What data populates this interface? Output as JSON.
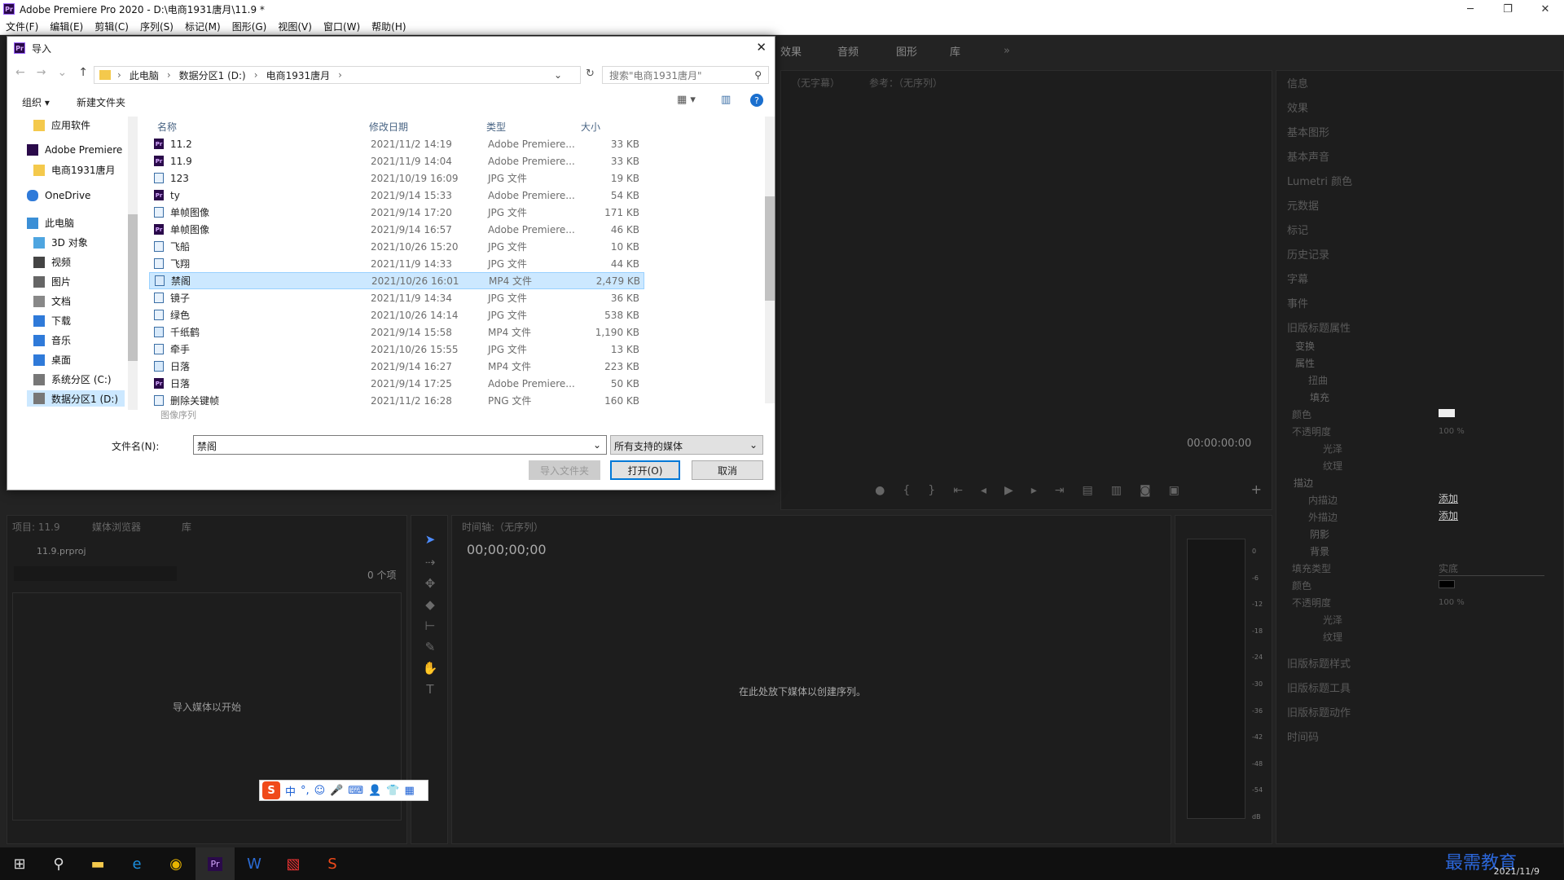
{
  "app": {
    "title": "Adobe Premiere Pro 2020 - D:\\电商1931唐月\\11.9  *",
    "logo": "Pr"
  },
  "window_controls": {
    "minimize": "─",
    "maximize": "❐",
    "close": "✕"
  },
  "menu": [
    "文件(F)",
    "编辑(E)",
    "剪辑(C)",
    "序列(S)",
    "标记(M)",
    "图形(G)",
    "视图(V)",
    "窗口(W)",
    "帮助(H)"
  ],
  "workspace_tabs": [
    "效果",
    "音频",
    "图形",
    "库"
  ],
  "more_tabs": "»",
  "source_monitor": {
    "tab1": "（无字幕）",
    "tab2": "参考：（无序列）",
    "timecode": "00:00:00:00"
  },
  "right_panels": [
    "信息",
    "效果",
    "基本图形",
    "基本声音",
    "Lumetri 颜色",
    "元数据",
    "标记",
    "历史记录",
    "字幕",
    "事件",
    "旧版标题属性"
  ],
  "legacy_title": {
    "transform": "变换",
    "properties": "属性",
    "distort": "扭曲",
    "fill": "填充",
    "color": "颜色",
    "opacity": "不透明度",
    "opacity_val": "100 %",
    "sheen": "光泽",
    "texture": "纹理",
    "strokes": "描边",
    "inner": "内描边",
    "outer": "外描边",
    "add": "添加",
    "shadow": "阴影",
    "background": "背景",
    "fill_type": "填充类型",
    "fill_type_val": "实底",
    "styles": "旧版标题样式",
    "tools": "旧版标题工具",
    "actions": "旧版标题动作",
    "timecode_panel": "时间码"
  },
  "project": {
    "tabs": [
      "项目: 11.9",
      "媒体浏览器",
      "库"
    ],
    "file": "11.9.prproj",
    "count": "0 个项",
    "empty": "导入媒体以开始"
  },
  "timeline": {
    "tab": "时间轴:（无序列）",
    "timecode": "00;00;00;00",
    "empty": "在此处放下媒体以创建序列。"
  },
  "meter": {
    "labels": [
      "0",
      "-6",
      "-12",
      "-18",
      "-24",
      "-30",
      "-36",
      "-42",
      "-48",
      "-54",
      "dB"
    ]
  },
  "dialog": {
    "title": "导入",
    "close": "✕",
    "address": [
      "此电脑",
      "数据分区1 (D:)",
      "电商1931唐月"
    ],
    "search_placeholder": "搜索\"电商1931唐月\"",
    "toolbar": {
      "organize": "组织 ▾",
      "new_folder": "新建文件夹",
      "help": "?"
    },
    "nav": [
      {
        "label": "应用软件"
      },
      {
        "label": "Adobe Premiere"
      },
      {
        "label": "电商1931唐月"
      },
      {
        "label": "OneDrive"
      },
      {
        "label": "此电脑"
      },
      {
        "label": "3D 对象"
      },
      {
        "label": "视频"
      },
      {
        "label": "图片"
      },
      {
        "label": "文档"
      },
      {
        "label": "下载"
      },
      {
        "label": "音乐"
      },
      {
        "label": "桌面"
      },
      {
        "label": "系统分区 (C:)"
      },
      {
        "label": "数据分区1 (D:)"
      }
    ],
    "columns": {
      "name": "名称",
      "date": "修改日期",
      "type": "类型",
      "size": "大小"
    },
    "files": [
      {
        "name": "11.2",
        "date": "2021/11/2 14:19",
        "type": "Adobe Premiere...",
        "size": "33 KB",
        "icon": "pr"
      },
      {
        "name": "11.9",
        "date": "2021/11/9 14:04",
        "type": "Adobe Premiere...",
        "size": "33 KB",
        "icon": "pr"
      },
      {
        "name": "123",
        "date": "2021/10/19 16:09",
        "type": "JPG 文件",
        "size": "19 KB",
        "icon": "img"
      },
      {
        "name": "ty",
        "date": "2021/9/14 15:33",
        "type": "Adobe Premiere...",
        "size": "54 KB",
        "icon": "pr"
      },
      {
        "name": "单帧图像",
        "date": "2021/9/14 17:20",
        "type": "JPG 文件",
        "size": "171 KB",
        "icon": "img"
      },
      {
        "name": "单帧图像",
        "date": "2021/9/14 16:57",
        "type": "Adobe Premiere...",
        "size": "46 KB",
        "icon": "pr"
      },
      {
        "name": "飞船",
        "date": "2021/10/26 15:20",
        "type": "JPG 文件",
        "size": "10 KB",
        "icon": "img"
      },
      {
        "name": "飞翔",
        "date": "2021/11/9 14:33",
        "type": "JPG 文件",
        "size": "44 KB",
        "icon": "img"
      },
      {
        "name": "禁阁",
        "date": "2021/10/26 16:01",
        "type": "MP4 文件",
        "size": "2,479 KB",
        "icon": "vid"
      },
      {
        "name": "镜子",
        "date": "2021/11/9 14:34",
        "type": "JPG 文件",
        "size": "36 KB",
        "icon": "img"
      },
      {
        "name": "绿色",
        "date": "2021/10/26 14:14",
        "type": "JPG 文件",
        "size": "538 KB",
        "icon": "img"
      },
      {
        "name": "千纸鹤",
        "date": "2021/9/14 15:58",
        "type": "MP4 文件",
        "size": "1,190 KB",
        "icon": "vid"
      },
      {
        "name": "牵手",
        "date": "2021/10/26 15:55",
        "type": "JPG 文件",
        "size": "13 KB",
        "icon": "img"
      },
      {
        "name": "日落",
        "date": "2021/9/14 16:27",
        "type": "MP4 文件",
        "size": "223 KB",
        "icon": "vid"
      },
      {
        "name": "日落",
        "date": "2021/9/14 17:25",
        "type": "Adobe Premiere...",
        "size": "50 KB",
        "icon": "pr"
      },
      {
        "name": "删除关键帧",
        "date": "2021/11/2 16:28",
        "type": "PNG 文件",
        "size": "160 KB",
        "icon": "img"
      }
    ],
    "image_sequence": "图像序列",
    "filename_label": "文件名(N):",
    "filename_value": "禁阁",
    "filetype": "所有支持的媒体",
    "import_folder": "导入文件夹",
    "open": "打开(O)",
    "cancel": "取消"
  },
  "ime": {
    "items": [
      "中",
      "°,",
      "☺",
      "🎤",
      "⌨",
      "👤",
      "👕",
      "▦"
    ]
  },
  "taskbar": {
    "date": "2021/11/9",
    "watermark": "最需教育"
  }
}
